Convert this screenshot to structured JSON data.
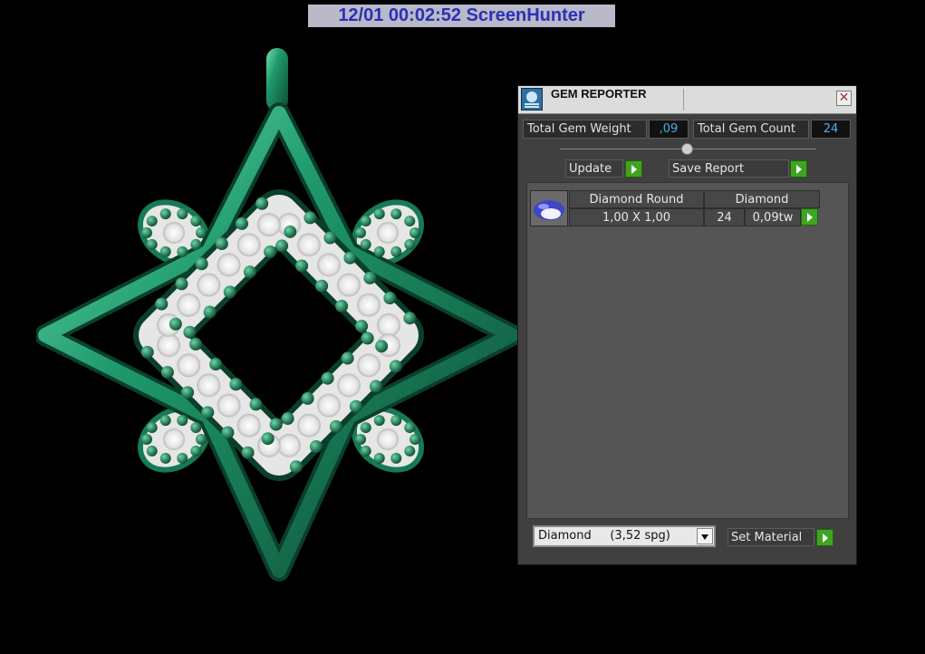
{
  "stamp": {
    "text": "12/01  00:02:52  ScreenHunter"
  },
  "panel": {
    "title": "GEM REPORTER",
    "close_glyph": "✕",
    "total_weight_label": "Total Gem Weight",
    "total_weight_value": ",09",
    "total_count_label": "Total Gem Count",
    "total_count_value": "24",
    "update_label": "Update",
    "save_report_label": "Save Report",
    "gem_row": {
      "shape": "Diamond Round",
      "material": "Diamond",
      "size": "1,00 X 1,00",
      "count": "24",
      "weight": "0,09tw"
    },
    "material_select_value": "Diamond     (3,52 spg)",
    "set_material_label": "Set Material"
  },
  "colors": {
    "metal": "#1f8a62",
    "stone": "#e8e8e8",
    "accent": "#3fa41f",
    "value_text": "#46b0e8"
  },
  "icons": [
    "gem-reporter-icon",
    "close-icon",
    "play-arrow-icon",
    "diamond-icon",
    "dropdown-arrow-icon"
  ]
}
